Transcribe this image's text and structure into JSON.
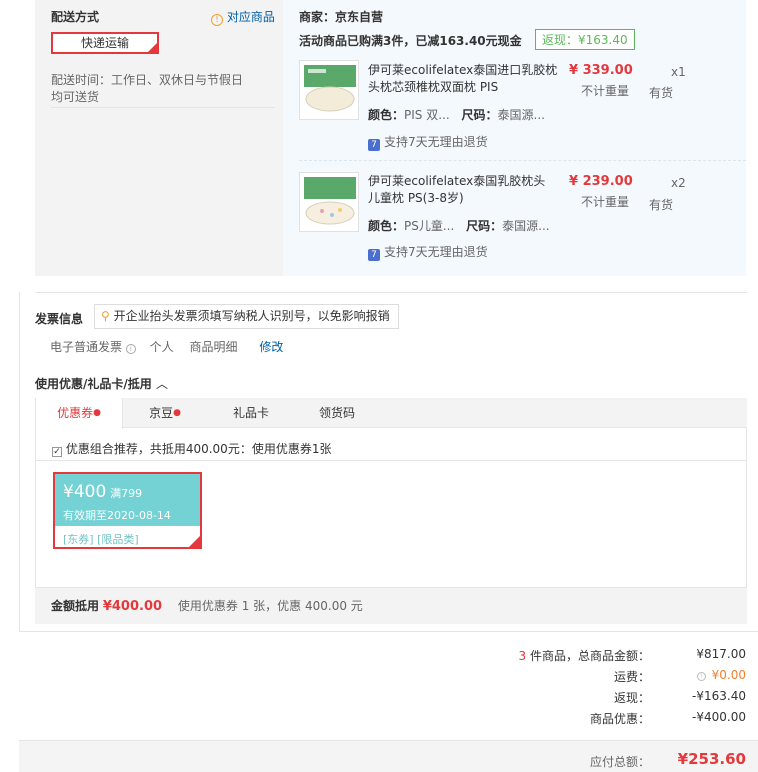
{
  "delivery": {
    "heading": "配送方式",
    "link": "对应商品",
    "method": "快递运输",
    "time_line1": "配送时间：工作日、双休日与节假日",
    "time_line2": "均可送货"
  },
  "shop": {
    "merchant_label": "商家：",
    "merchant": "京东自营",
    "promo": "活动商品已购满3件，已减163.40元现金",
    "cashback_tag": "返现：¥163.40",
    "items": [
      {
        "title_line1": "伊可莱ecolifelatex泰国进口乳胶枕",
        "title_line2": "头枕芯颈椎枕双面枕 PIS",
        "color_label": "颜色：",
        "color": "PIS 双...",
        "size_label": "尺码：",
        "size": "泰国源...",
        "price": "¥ 339.00",
        "weight": "不计重量",
        "qty": "x1",
        "stock": "有货",
        "return_policy": "支持7天无理由退货"
      },
      {
        "title_line1": "伊可莱ecolifelatex泰国乳胶枕头",
        "title_line2": "儿童枕 PS(3-8岁)",
        "color_label": "颜色：",
        "color": "PS儿童...",
        "size_label": "尺码：",
        "size": "泰国源...",
        "price": "¥ 239.00",
        "weight": "不计重量",
        "qty": "x2",
        "stock": "有货",
        "return_policy": "支持7天无理由退货"
      }
    ]
  },
  "invoice": {
    "heading": "发票信息",
    "tip": "开企业抬头发票须填写纳税人识别号，以免影响报销",
    "type": "电子普通发票",
    "title": "个人",
    "content": "商品明细",
    "edit": "修改"
  },
  "discounts": {
    "heading": "使用优惠/礼品卡/抵用",
    "tabs": [
      "优惠券",
      "京豆",
      "礼品卡",
      "领货码"
    ],
    "recommend": "优惠组合推荐，共抵用400.00元：使用优惠券1张",
    "coupon": {
      "amount": "¥400",
      "condition": "满799",
      "expiry": "有效期至2020-08-14",
      "tags": "[东券] [限品类]"
    },
    "footer_label": "金额抵用",
    "footer_amount": "¥400.00",
    "footer_desc": "使用优惠券 1 张，优惠 400.00 元"
  },
  "summary": {
    "count": "3",
    "count_suffix": "件商品，总商品金额：",
    "goods_total": "¥817.00",
    "shipping_label": "运费：",
    "shipping": "¥0.00",
    "cashback_label": "返现：",
    "cashback": "-¥163.40",
    "discount_label": "商品优惠：",
    "discount": "-¥400.00",
    "payable_label": "应付总额：",
    "payable": "¥253.60"
  },
  "colors": {
    "accent_red": "#e4393c",
    "coupon_teal": "#74d2d4",
    "cashback_green": "#5cb85c"
  }
}
